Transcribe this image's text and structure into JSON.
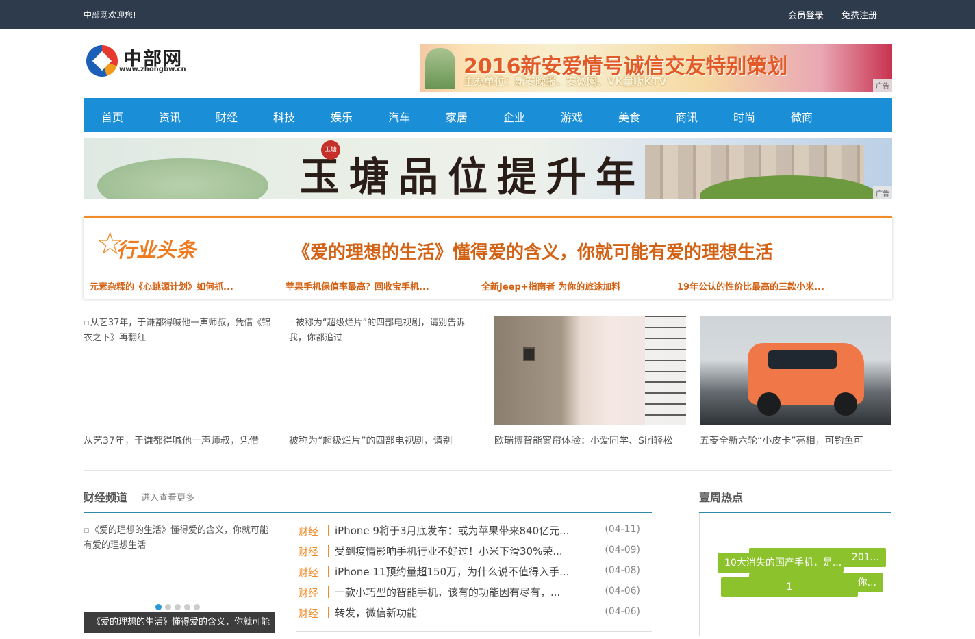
{
  "topbar": {
    "welcome": "中部网欢迎您!",
    "login": "会员登录",
    "register": "免费注册"
  },
  "logo": {
    "name": "中部网",
    "url": "www.zhongbw.cn"
  },
  "ad_top": {
    "line1": "2016新安爱情号诚信交友特别策划",
    "line2": "主办单位：新安晚报、安徽网、VK量贩KTV",
    "tag": "广告"
  },
  "nav": [
    "首页",
    "资讯",
    "财经",
    "科技",
    "娱乐",
    "汽车",
    "家居",
    "企业",
    "游戏",
    "美食",
    "商讯",
    "时尚",
    "微商"
  ],
  "ad_banner": {
    "text": "玉塘品位提升年",
    "seal": "玉塘",
    "tag": "广告"
  },
  "headline": {
    "logo_text": "行业头条",
    "title": "《爱的理想的生活》懂得爱的含义，你就可能有爱的理想生活",
    "links": [
      "元素杂糅的《心跳源计划》如何抓...",
      "苹果手机保值率最高？回收宝手机...",
      "全新Jeep+指南者 为你的旅途加料",
      "19年公认的性价比最高的三款小米..."
    ]
  },
  "cards": [
    {
      "alt": "从艺37年，于谦都得喊他一声师叔，凭借《锦衣之下》再翻红",
      "caption": "从艺37年，于谦都得喊他一声师叔，凭借"
    },
    {
      "alt": "被称为“超级烂片”的四部电视剧，请别告诉我，你都追过",
      "caption": "被称为“超级烂片”的四部电视剧，请别"
    },
    {
      "alt": "",
      "caption": "欧瑞博智能窗帘体验：小爱同学、Siri轻松"
    },
    {
      "alt": "",
      "caption": "五菱全新六轮“小皮卡”亮相，可钓鱼可"
    }
  ],
  "finance": {
    "title": "财经频道",
    "more": "进入查看更多",
    "slide_alt": "《爱的理想的生活》懂得爱的含义，你就可能有爱的理想生活",
    "slide_caption": "《爱的理想的生活》懂得爱的含义，你就可能",
    "dots": 5,
    "active_dot": 1,
    "news": [
      {
        "cat": "财经",
        "title": "iPhone 9将于3月底发布：或为苹果带来840亿元...",
        "date": "(04-11)"
      },
      {
        "cat": "财经",
        "title": "受到疫情影响手机行业不好过！小米下滑30%荣...",
        "date": "(04-09)"
      },
      {
        "cat": "财经",
        "title": "iPhone 11预约量超150万，为什么说不值得入手...",
        "date": "(04-08)"
      },
      {
        "cat": "财经",
        "title": "一款小巧型的智能手机，该有的功能因有尽有，...",
        "date": "(04-06)"
      },
      {
        "cat": "财经",
        "title": "转发，微信新功能",
        "date": "(04-06)"
      }
    ]
  },
  "hot": {
    "title": "壹周热点",
    "tags": [
      "201...",
      "你...",
      "10大消失的国产手机，是...",
      "1"
    ]
  },
  "colors": {
    "nav": "#1a8fd8",
    "topbar": "#2e3b4c",
    "accent": "#f08c2a",
    "tag": "#8cc22c"
  }
}
